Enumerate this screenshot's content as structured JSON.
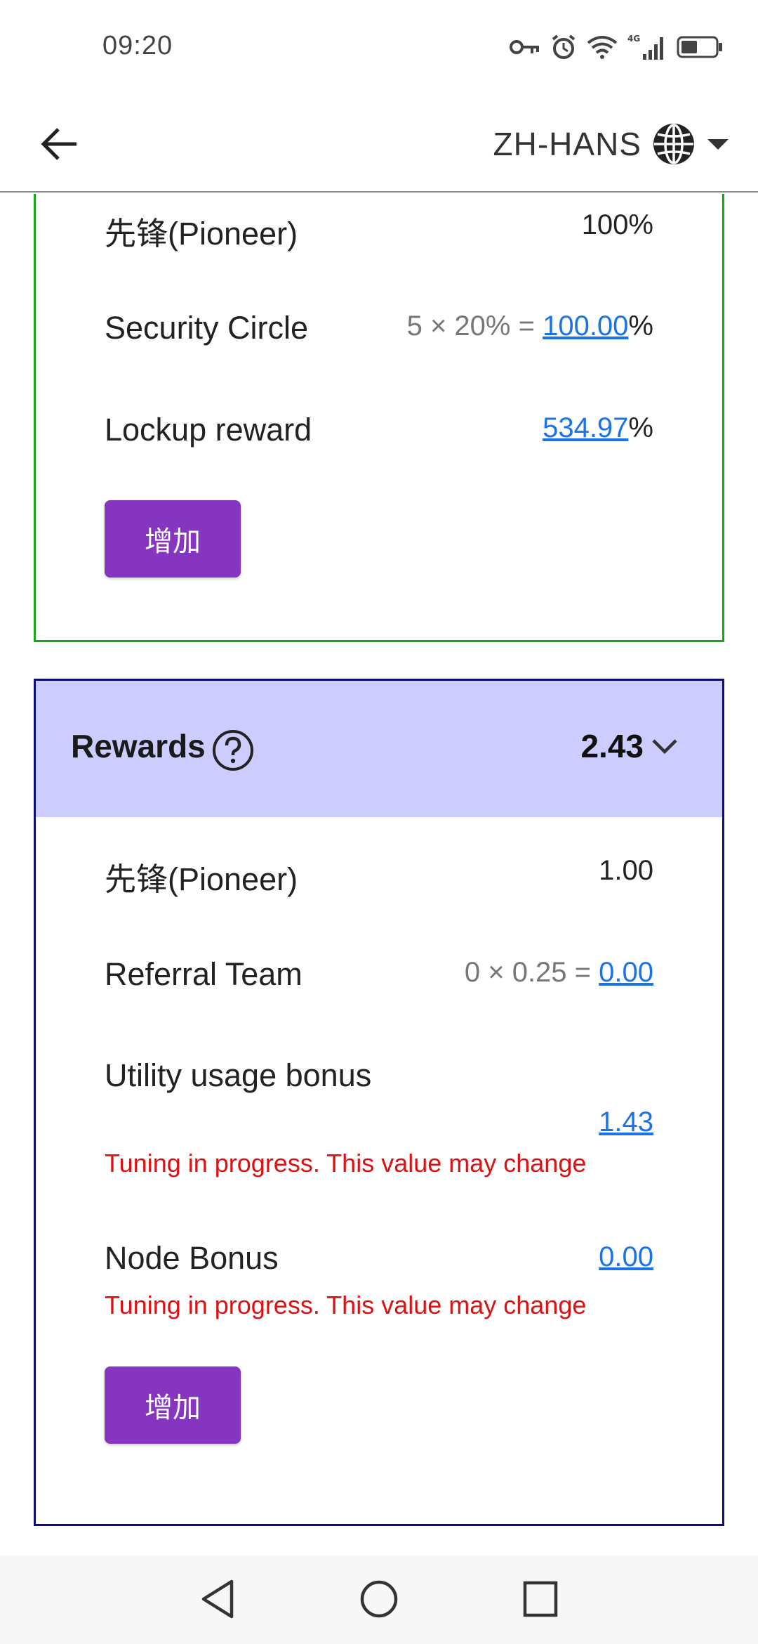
{
  "status_bar": {
    "time": "09:20",
    "icons": [
      "key-icon",
      "alarm-icon",
      "wifi-icon",
      "signal-4g-icon",
      "battery-icon"
    ],
    "network": "4G"
  },
  "app_bar": {
    "back_icon": "arrow-left-icon",
    "language": "ZH-HANS",
    "language_icon": "globe-icon",
    "dropdown_icon": "caret-down-icon"
  },
  "mining_card": {
    "border_color": "#1aa61a",
    "rows": [
      {
        "label": "先锋(Pioneer)",
        "value": "100%"
      },
      {
        "label": "Security Circle",
        "formula": "5 × 20% = ",
        "value": "100.00",
        "suffix": "%"
      },
      {
        "label": "Lockup reward",
        "value": "534.97",
        "suffix": "%"
      }
    ],
    "add_button": "增加"
  },
  "rewards_card": {
    "border_color": "#0c0c7a",
    "header_bg": "#ccccff",
    "title": "Rewards",
    "help_icon": "question-circle-icon",
    "total": "2.43",
    "expand_icon": "chevron-down-icon",
    "rows": [
      {
        "label": "先锋(Pioneer)",
        "value": "1.00"
      },
      {
        "label": "Referral Team",
        "formula": "0 × 0.25 = ",
        "value": "0.00"
      },
      {
        "label": "Utility usage bonus",
        "value": "1.43",
        "warning": "Tuning in progress. This value may change"
      },
      {
        "label": "Node Bonus",
        "value": "0.00",
        "warning": "Tuning in progress. This value may change"
      }
    ],
    "add_button": "增加"
  },
  "nav_bar": {
    "icons": [
      "nav-back-icon",
      "nav-home-icon",
      "nav-recents-icon"
    ]
  },
  "colors": {
    "accent": "#8535c0",
    "link": "#1a73e8",
    "warning": "#dd1111"
  }
}
